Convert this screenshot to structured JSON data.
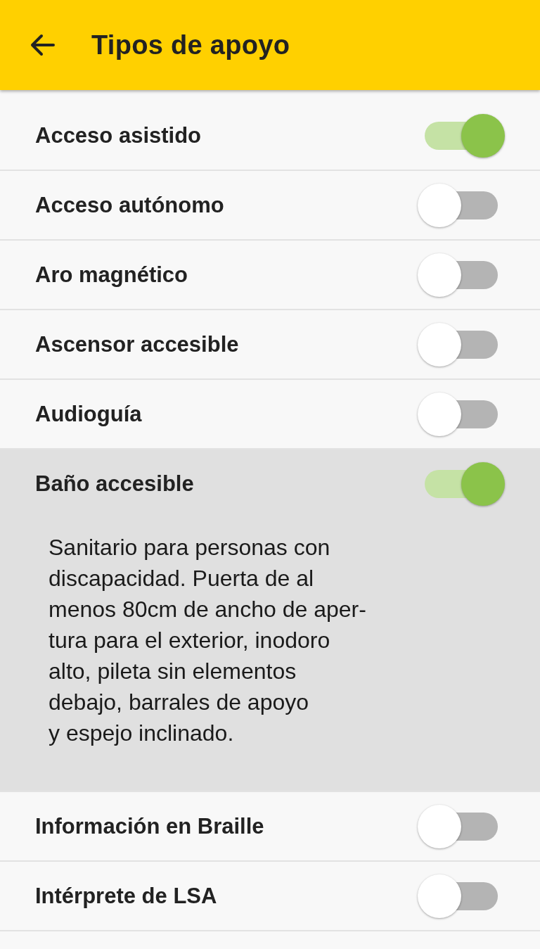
{
  "header": {
    "title": "Tipos de apoyo"
  },
  "items": [
    {
      "label": "Acceso asistido",
      "on": true,
      "expanded": false
    },
    {
      "label": "Acceso autónomo",
      "on": false,
      "expanded": false
    },
    {
      "label": "Aro magnético",
      "on": false,
      "expanded": false
    },
    {
      "label": "Ascensor accesible",
      "on": false,
      "expanded": false
    },
    {
      "label": "Audioguía",
      "on": false,
      "expanded": false
    },
    {
      "label": "Baño accesible",
      "on": true,
      "expanded": true,
      "description": "Sanitario para personas con\ndiscapacidad. Puerta de al\nmenos 80cm de ancho de aper-\ntura para el exterior, inodoro\nalto, pileta sin elementos\ndebajo, barrales de apoyo\ny espejo inclinado."
    },
    {
      "label": "Información en Braille",
      "on": false,
      "expanded": false
    },
    {
      "label": "Intérprete de LSA",
      "on": false,
      "expanded": false
    }
  ]
}
